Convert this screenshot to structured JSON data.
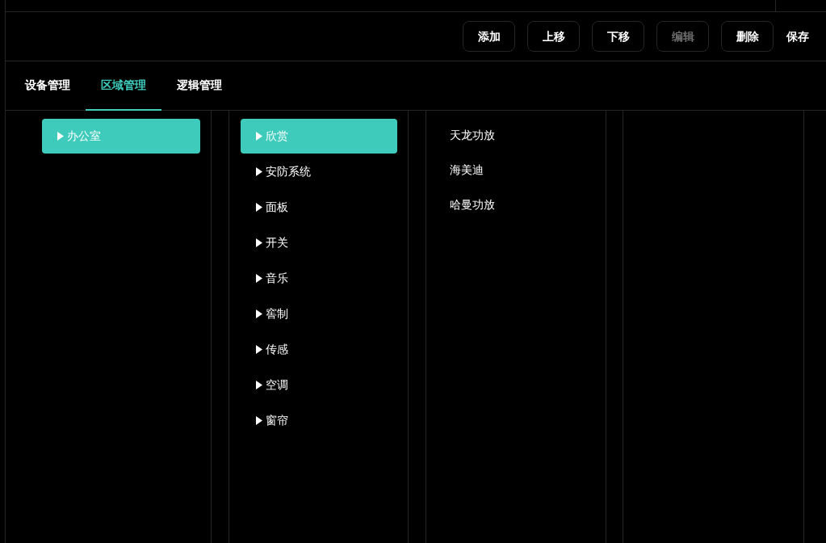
{
  "toolbar": {
    "buttons": [
      {
        "label": "添加",
        "kind": "outlined",
        "disabled": false
      },
      {
        "label": "上移",
        "kind": "outlined",
        "disabled": false
      },
      {
        "label": "下移",
        "kind": "outlined",
        "disabled": false
      },
      {
        "label": "编辑",
        "kind": "outlined",
        "disabled": true
      },
      {
        "label": "删除",
        "kind": "outlined",
        "disabled": false
      },
      {
        "label": "保存",
        "kind": "plain",
        "disabled": false
      }
    ]
  },
  "tabs": [
    {
      "label": "设备管理",
      "selected": false
    },
    {
      "label": "区域管理",
      "selected": true
    },
    {
      "label": "逻辑管理",
      "selected": false
    }
  ],
  "areas": [
    {
      "label": "办公室",
      "selected": true
    }
  ],
  "categories": [
    {
      "label": "欣赏",
      "selected": true
    },
    {
      "label": "安防系统",
      "selected": false
    },
    {
      "label": "面板",
      "selected": false
    },
    {
      "label": "开关",
      "selected": false
    },
    {
      "label": "音乐",
      "selected": false
    },
    {
      "label": "窖制",
      "selected": false
    },
    {
      "label": "传感",
      "selected": false
    },
    {
      "label": "空调",
      "selected": false
    },
    {
      "label": "窗帘",
      "selected": false
    }
  ],
  "devices": [
    {
      "label": "天龙功放"
    },
    {
      "label": "海美迪"
    },
    {
      "label": "哈曼功放"
    }
  ]
}
